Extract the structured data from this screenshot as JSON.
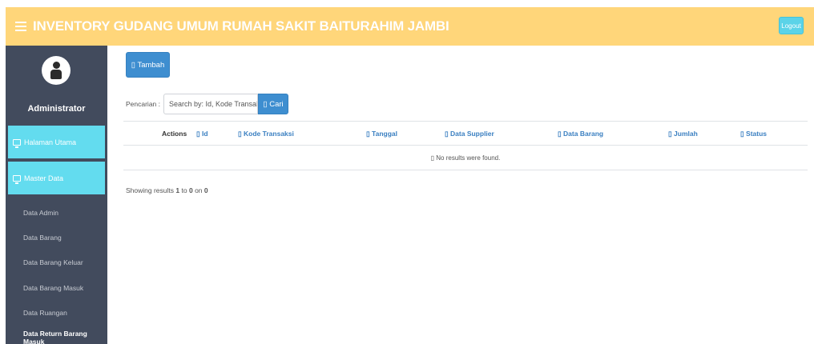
{
  "header": {
    "title": "INVENTORY GUDANG UMUM RUMAH SAKIT BAITURAHIM JAMBI",
    "logout_label": "Logout",
    "color": "#ffd67a"
  },
  "sidebar": {
    "user_name": "Administrator",
    "menu": [
      {
        "label": "Halaman Utama",
        "icon": "monitor-icon"
      },
      {
        "label": "Master Data",
        "icon": "monitor-icon"
      }
    ],
    "submenu": [
      {
        "label": "Data Admin"
      },
      {
        "label": "Data Barang"
      },
      {
        "label": "Data Barang Keluar"
      },
      {
        "label": "Data Barang Masuk"
      },
      {
        "label": "Data Ruangan"
      },
      {
        "label": "Data Return Barang Masuk",
        "active": true
      }
    ],
    "background": "#424b5d",
    "accent": "#63dcef"
  },
  "main": {
    "add_button": "▯ Tambah",
    "search": {
      "label": "Pencarian :",
      "placeholder": "Search by: Id, Kode Transaksi",
      "button": "▯ Cari"
    },
    "table": {
      "columns": [
        "Actions",
        "▯ Id",
        "▯ Kode Transaksi",
        "▯ Tanggal",
        "▯ Data Supplier",
        "▯ Data Barang",
        "▯ Jumlah",
        "▯ Status"
      ],
      "empty_message": "▯ No results were found."
    },
    "summary": {
      "prefix": "Showing results",
      "from": "1",
      "to_word": "to",
      "to": "0",
      "on_word": "on",
      "total": "0"
    },
    "primary_color": "#3e8ed0"
  }
}
